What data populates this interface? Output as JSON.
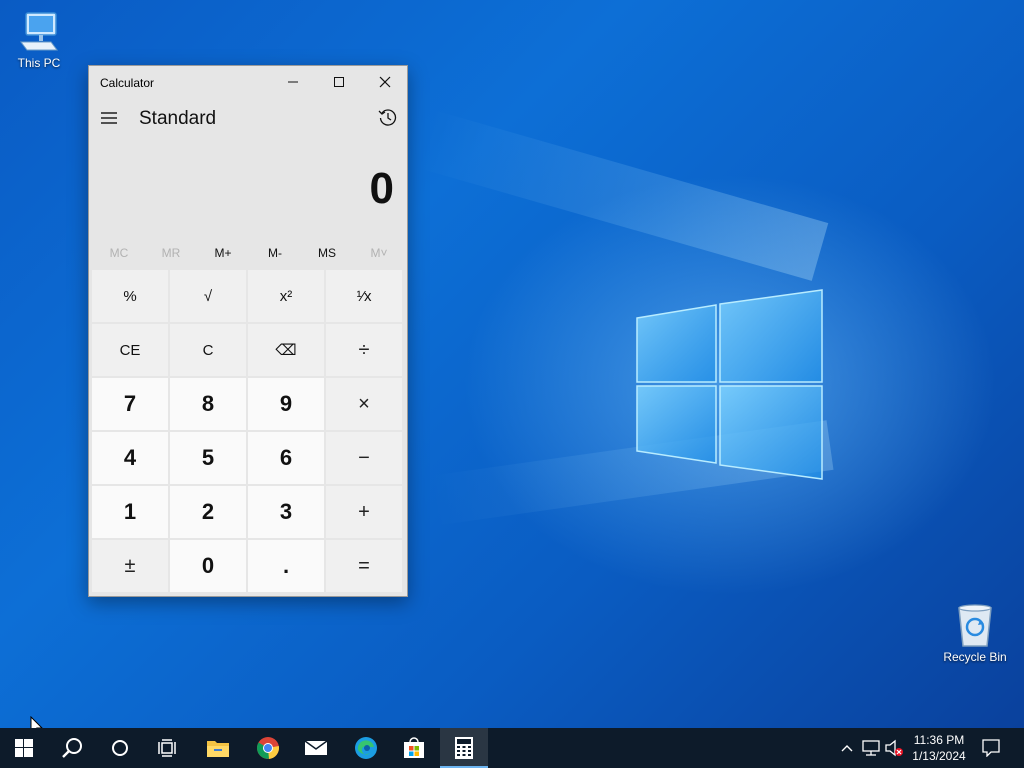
{
  "desktop": {
    "icons": [
      {
        "label": "This PC",
        "icon": "computer-icon"
      },
      {
        "label": "Recycle Bin",
        "icon": "recycle-bin-icon"
      }
    ]
  },
  "calculator": {
    "window_title": "Calculator",
    "mode_title": "Standard",
    "display_value": "0",
    "memory": [
      {
        "label": "MC",
        "enabled": false
      },
      {
        "label": "MR",
        "enabled": false
      },
      {
        "label": "M+",
        "enabled": true
      },
      {
        "label": "M-",
        "enabled": true
      },
      {
        "label": "MS",
        "enabled": true
      },
      {
        "label": "M˅",
        "enabled": false
      }
    ],
    "keys": [
      {
        "label": "%",
        "name": "percent-button",
        "kind": "fn"
      },
      {
        "label": "√",
        "name": "square-root-button",
        "kind": "fn"
      },
      {
        "label": "x²",
        "name": "square-button",
        "kind": "fn"
      },
      {
        "label": "¹⁄x",
        "name": "reciprocal-button",
        "kind": "fn"
      },
      {
        "label": "CE",
        "name": "clear-entry-button",
        "kind": "fn"
      },
      {
        "label": "C",
        "name": "clear-button",
        "kind": "fn"
      },
      {
        "label": "⌫",
        "name": "backspace-button",
        "kind": "fn"
      },
      {
        "label": "÷",
        "name": "divide-button",
        "kind": "op"
      },
      {
        "label": "7",
        "name": "digit-7-button",
        "kind": "num"
      },
      {
        "label": "8",
        "name": "digit-8-button",
        "kind": "num"
      },
      {
        "label": "9",
        "name": "digit-9-button",
        "kind": "num"
      },
      {
        "label": "×",
        "name": "multiply-button",
        "kind": "op"
      },
      {
        "label": "4",
        "name": "digit-4-button",
        "kind": "num"
      },
      {
        "label": "5",
        "name": "digit-5-button",
        "kind": "num"
      },
      {
        "label": "6",
        "name": "digit-6-button",
        "kind": "num"
      },
      {
        "label": "−",
        "name": "subtract-button",
        "kind": "op"
      },
      {
        "label": "1",
        "name": "digit-1-button",
        "kind": "num"
      },
      {
        "label": "2",
        "name": "digit-2-button",
        "kind": "num"
      },
      {
        "label": "3",
        "name": "digit-3-button",
        "kind": "num"
      },
      {
        "label": "+",
        "name": "add-button",
        "kind": "op"
      },
      {
        "label": "±",
        "name": "negate-button",
        "kind": "op"
      },
      {
        "label": "0",
        "name": "digit-0-button",
        "kind": "num"
      },
      {
        "label": ".",
        "name": "decimal-button",
        "kind": "num"
      },
      {
        "label": "=",
        "name": "equals-button",
        "kind": "op"
      }
    ]
  },
  "taskbar": {
    "pinned": [
      {
        "icon": "windows-start-icon"
      },
      {
        "icon": "search-icon"
      },
      {
        "icon": "cortana-icon"
      },
      {
        "icon": "task-view-icon"
      },
      {
        "icon": "file-explorer-icon"
      },
      {
        "icon": "chrome-icon"
      },
      {
        "icon": "mail-icon"
      },
      {
        "icon": "edge-icon"
      },
      {
        "icon": "store-icon"
      },
      {
        "icon": "calculator-icon",
        "active": true
      }
    ],
    "clock": {
      "time": "11:36 PM",
      "date": "1/13/2024"
    }
  }
}
